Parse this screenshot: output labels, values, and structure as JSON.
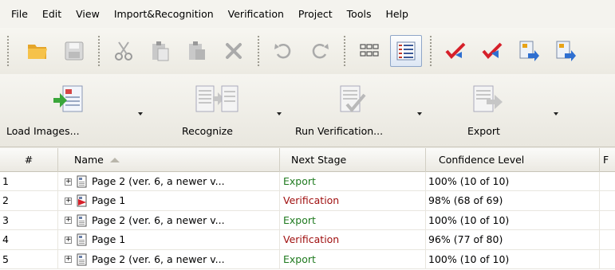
{
  "menu": [
    "File",
    "Edit",
    "View",
    "Import&Recognition",
    "Verification",
    "Project",
    "Tools",
    "Help"
  ],
  "toolbar_icons": [
    "open-folder-icon",
    "save-icon",
    "cut-icon",
    "paste-icon",
    "paste-special-icon",
    "delete-icon",
    "undo-icon",
    "redo-icon",
    "thumbnails-view-icon",
    "details-view-icon",
    "verify-icon",
    "verify-all-icon",
    "send-to-stage-icon",
    "send-to-stage-2-icon"
  ],
  "big_buttons": {
    "load_images": "Load Images...",
    "recognize": "Recognize",
    "run_verification": "Run Verification...",
    "export": "Export"
  },
  "grid": {
    "columns": [
      "#",
      "Name",
      "Next Stage",
      "Confidence Level",
      "F"
    ],
    "rows": [
      {
        "num": "1",
        "name": "Page 2 (ver. 6, a newer v...",
        "stage": "Export",
        "stage_type": "export",
        "confidence": "100% (10 of 10)",
        "icon": "page-icon"
      },
      {
        "num": "2",
        "name": "Page 1",
        "stage": "Verification",
        "stage_type": "verification",
        "confidence": "98% (68 of 69)",
        "icon": "page-flagged-icon"
      },
      {
        "num": "3",
        "name": "Page 2 (ver. 6, a newer v...",
        "stage": "Export",
        "stage_type": "export",
        "confidence": "100% (10 of 10)",
        "icon": "page-icon"
      },
      {
        "num": "4",
        "name": "Page 1",
        "stage": "Verification",
        "stage_type": "verification",
        "confidence": "96% (77 of 80)",
        "icon": "page-icon"
      },
      {
        "num": "5",
        "name": "Page 2 (ver. 6, a newer v...",
        "stage": "Export",
        "stage_type": "export",
        "confidence": "100% (10 of 10)",
        "icon": "page-icon"
      }
    ]
  },
  "colors": {
    "export": "#1f7a1f",
    "verification": "#a01010",
    "accent": "#e8a317"
  }
}
